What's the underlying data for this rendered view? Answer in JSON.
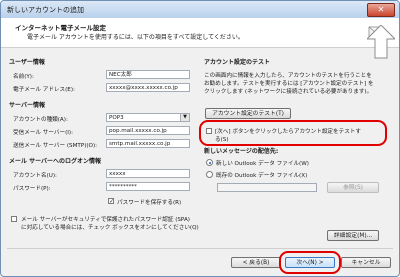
{
  "window": {
    "title": "新しいアカウントの追加",
    "close_glyph": "✕"
  },
  "header": {
    "title": "インターネット電子メール設定",
    "subtitle": "電子メール アカウントを使用するには、以下の項目をすべて設定してください。"
  },
  "user_info": {
    "section": "ユーザー情報",
    "name_label": "名前(Y):",
    "name_value": "NEC太郎",
    "email_label": "電子メール アドレス(E):",
    "email_value": "xxxxx@xxxx.xxxxx.co.jp"
  },
  "server_info": {
    "section": "サーバー情報",
    "account_type_label": "アカウントの種類(A):",
    "account_type_value": "POP3",
    "incoming_label": "受信メール サーバー(I):",
    "incoming_value": "pop.mail.xxxxx.co.jp",
    "outgoing_label": "送信メール サーバー (SMTP)(O):",
    "outgoing_value": "smtp.mail.xxxxx.co.jp"
  },
  "logon_info": {
    "section": "メール サーバーへのログオン情報",
    "account_label": "アカウント名(U):",
    "account_value": "xxxxx",
    "password_label": "パスワード(P):",
    "password_value": "**********",
    "remember_password_label": "パスワードを保存する(R)",
    "remember_password_checked": true,
    "spa_label_line1": "メール サーバーがセキュリティで保護されたパスワード認証 (SPA) ",
    "spa_label_line2": "に対応している場合には、チェック ボックスをオンにしてください(Q)",
    "spa_checked": false
  },
  "test": {
    "section": "アカウント設定のテスト",
    "desc_line1": "この画面内に情報を入力したら、アカウントのテストを行うことを",
    "desc_line2": "お勧めします。テストを実行するには [アカウント設定のテスト] を",
    "desc_line3": "クリックします (ネットワークに接続されている必要があります)。",
    "test_button": "アカウント設定のテスト(T)",
    "auto_test_label_line1": "[次へ] ボタンをクリックしたらアカウント設定をテストす",
    "auto_test_label_line2": "る(S)",
    "auto_test_checked": false
  },
  "delivery": {
    "section": "新しいメッセージの配信先:",
    "option_new": "新しい Outlook データ ファイル(W)",
    "option_existing": "既存の Outlook データ ファイル(X)",
    "selected": "new",
    "browse_button": "参照(S)"
  },
  "more_settings_button": "詳細設定(M)...",
  "footer": {
    "back_button": "< 戻る(B)",
    "next_button": "次へ(N) >",
    "cancel_button": "キャンセル"
  },
  "colors": {
    "highlight": "#e10000",
    "header_bg": "#ffffff",
    "dialog_bg": "#f0f0f0"
  }
}
